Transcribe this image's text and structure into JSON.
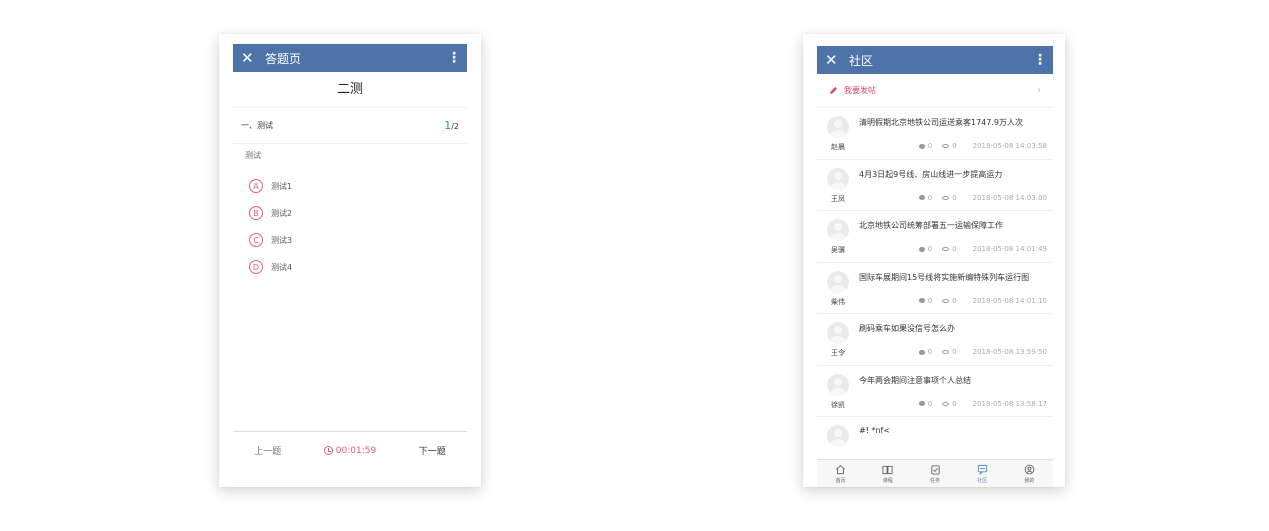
{
  "quiz_screen": {
    "appbar": {
      "title": "答题页"
    },
    "quiz_title": "二测",
    "section_label": "一、测试",
    "progress": {
      "current": "1",
      "total": "/2"
    },
    "question_text": "测试",
    "options": [
      {
        "letter": "A",
        "text": "测试1"
      },
      {
        "letter": "B",
        "text": "测试2"
      },
      {
        "letter": "C",
        "text": "测试3"
      },
      {
        "letter": "D",
        "text": "测试4"
      }
    ],
    "footer": {
      "prev_label": "上一题",
      "timer": "00:01:59",
      "next_label": "下一题"
    }
  },
  "community_screen": {
    "appbar": {
      "title": "社区"
    },
    "post_cta_label": "我要发帖",
    "posts": [
      {
        "title": "清明假期北京地铁公司运送乘客1747.9万人次",
        "author": "赵晨",
        "comments": "0",
        "views": "0",
        "date": "2018-05-08 14:03:58"
      },
      {
        "title": "4月3日起9号线、房山线进一步提高运力",
        "author": "王凤",
        "comments": "0",
        "views": "0",
        "date": "2018-05-08 14:03:00"
      },
      {
        "title": "北京地铁公司统筹部署五一运输保障工作",
        "author": "吴骥",
        "comments": "0",
        "views": "0",
        "date": "2018-05-08 14:01:49"
      },
      {
        "title": "国际车展期间15号线将实施新编特殊列车运行图",
        "author": "柴伟",
        "comments": "0",
        "views": "0",
        "date": "2018-05-08 14:01:10"
      },
      {
        "title": "刷码乘车如果没信号怎么办",
        "author": "王令",
        "comments": "0",
        "views": "0",
        "date": "2018-05-08 13:59:50"
      },
      {
        "title": "今年两会期间注意事项个人总结",
        "author": "徐凯",
        "comments": "0",
        "views": "0",
        "date": "2018-05-08 13:58:17"
      },
      {
        "title": "#! *nf<",
        "author": "",
        "comments": "",
        "views": "",
        "date": ""
      }
    ],
    "tabs": [
      {
        "label": "首页",
        "icon": "home-icon"
      },
      {
        "label": "课程",
        "icon": "book-icon"
      },
      {
        "label": "任务",
        "icon": "task-icon"
      },
      {
        "label": "社区",
        "icon": "chat-icon",
        "active": true
      },
      {
        "label": "我的",
        "icon": "user-icon"
      }
    ],
    "colors": {
      "appbar": "#4d73a8",
      "accent": "#d44a6a",
      "active_tab": "#4d8ccc"
    }
  }
}
